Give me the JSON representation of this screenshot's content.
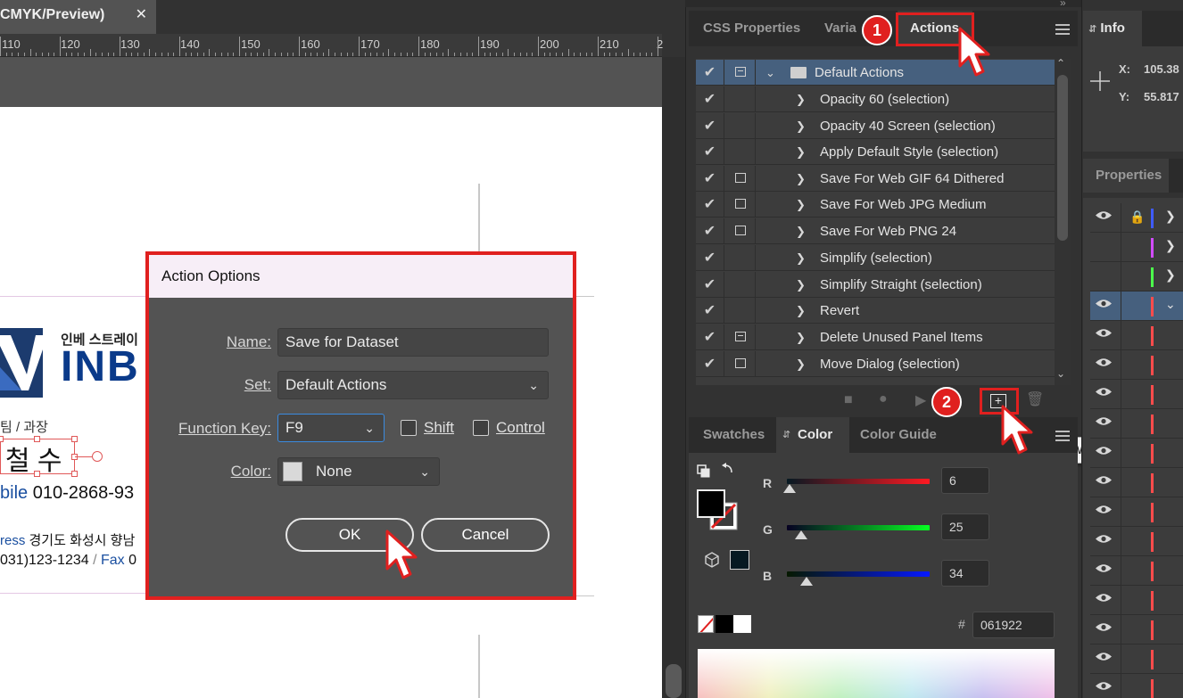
{
  "document": {
    "tab_title": "CMYK/Preview)",
    "tab_close": "✕",
    "ruler_labels": [
      "110",
      "120",
      "130",
      "140",
      "150",
      "160",
      "170",
      "180",
      "190",
      "200",
      "210",
      "2"
    ],
    "card": {
      "company_small": "인베 스트레이",
      "company_big": "INB",
      "dept": "팀 / 과장",
      "name": "철 수",
      "mobile_label": "bile",
      "mobile_value": " 010-2868-93",
      "address_label": "ress",
      "address_value": " 경기도 화성시 향남",
      "tel_value": "031)123-1234",
      "tel_sep": " / ",
      "fax_label": "Fax",
      "fax_value": " 0"
    }
  },
  "dialog": {
    "title": "Action Options",
    "name_label": "Name:",
    "name_value": "Save for Dataset",
    "set_label": "Set:",
    "set_value": "Default Actions",
    "function_key_label": "Function Key:",
    "function_key_value": "F9",
    "shift_label": "Shift",
    "control_label": "Control",
    "color_label": "Color:",
    "color_value": "None",
    "ok_label": "OK",
    "cancel_label": "Cancel"
  },
  "panels": {
    "top_tabs": [
      "CSS Properties",
      "Varia",
      "Actions"
    ],
    "actions": {
      "set_name": "Default Actions",
      "items": [
        "Opacity 60 (selection)",
        "Opacity 40 Screen (selection)",
        "Apply Default Style (selection)",
        "Save For Web GIF 64 Dithered",
        "Save For Web JPG Medium",
        "Save For Web PNG 24",
        "Simplify (selection)",
        "Simplify Straight (selection)",
        "Revert",
        "Delete Unused Panel Items",
        "Move Dialog (selection)"
      ],
      "tooltip": "Create New Action"
    },
    "color_tabs": [
      "Swatches",
      "Color",
      "Color Guide"
    ],
    "color": {
      "r_label": "R",
      "r_value": "6",
      "g_label": "G",
      "g_value": "25",
      "b_label": "B",
      "b_value": "34",
      "hex_hash": "#",
      "hex_value": "061922"
    },
    "info": {
      "tab": "Info",
      "x_label": "X:",
      "x_value": "105.38",
      "y_label": "Y:",
      "y_value": "55.817"
    },
    "properties_tab": "Properties"
  },
  "steps": {
    "one": "1",
    "two": "2"
  },
  "colors": {
    "highlight_red": "#e0201f",
    "selected_row": "#46607e",
    "layer_blue": "#3f5bff",
    "layer_magenta": "#d24cff",
    "layer_green": "#4cff4c",
    "layer_red": "#ff4c4c"
  }
}
